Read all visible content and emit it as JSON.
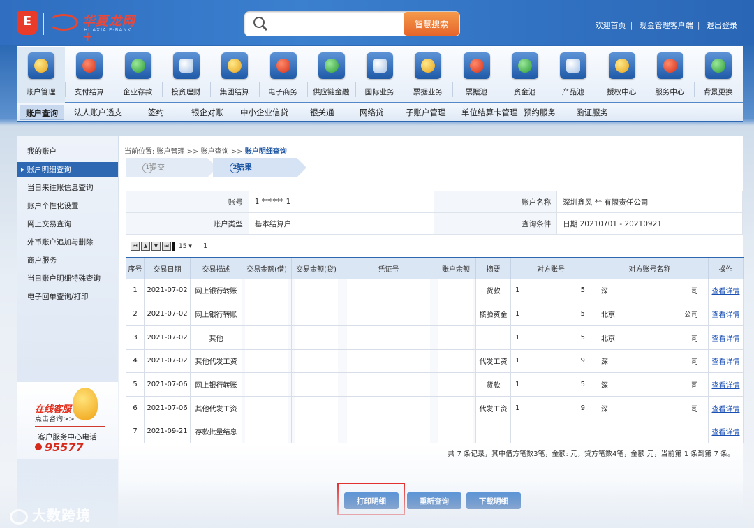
{
  "header": {
    "brand_cn": "华夏龙网+",
    "brand_en": "HUAXIA E-BANK",
    "logo_char": "E",
    "search": {
      "placeholder": "",
      "button": "智慧搜索"
    },
    "links": [
      "欢迎首页",
      "现金管理客户端",
      "退出登录"
    ]
  },
  "nav": [
    "账户管理",
    "支付结算",
    "企业存款",
    "投资理财",
    "集团结算",
    "电子商务",
    "供应链金融",
    "国际业务",
    "票据业务",
    "票据池",
    "资金池",
    "产品池",
    "授权中心",
    "服务中心",
    "背景更换"
  ],
  "subnav": [
    "账户查询",
    "法人账户透支",
    "签约",
    "银企对账",
    "中小企业信贷",
    "银关通",
    "网络贷",
    "子账户管理",
    "单位结算卡管理",
    "预约服务",
    "函证服务"
  ],
  "sidebar": [
    "我的账户",
    "账户明细查询",
    "当日来往账信息查询",
    "账户个性化设置",
    "网上交易查询",
    "外币账户追加与删除",
    "商户服务",
    "当日账户明细特殊查询",
    "电子回单查询/打印"
  ],
  "service": {
    "title": "在线客服",
    "sub": "点击咨询>>",
    "hotline_label": "客户服务中心电话",
    "hotline": "95577"
  },
  "crumb": {
    "prefix": "当前位置: 账户管理 >> 账户查询 >> ",
    "current": "账户明细查询"
  },
  "steps": [
    {
      "num": "1",
      "label": "提交"
    },
    {
      "num": "2",
      "label": "结果"
    }
  ],
  "info": {
    "account_label": "账号",
    "account_value": "1 ****** 1",
    "name_label": "账户名称",
    "name_value": "深圳鑫风 ** 有限责任公司",
    "type_label": "账户类型",
    "type_value": "基本结算户",
    "cond_label": "查询条件",
    "cond_value": "日期 20210701 - 20210921"
  },
  "pager": {
    "page_size": "15",
    "current_page": "1"
  },
  "grid": {
    "headers": [
      "序号",
      "交易日期",
      "交易描述",
      "交易金额(借)",
      "交易金额(贷)",
      "凭证号",
      "账户余额",
      "摘要",
      "对方账号",
      "对方账号名称",
      "操作"
    ],
    "rows": [
      {
        "no": "1",
        "date": "2021-07-02",
        "desc": "网上银行转账",
        "summary": "货款",
        "acct_a": "1",
        "acct_b": "5",
        "name_a": "深",
        "name_b": "司",
        "op": "查看详情"
      },
      {
        "no": "2",
        "date": "2021-07-02",
        "desc": "网上银行转账",
        "summary": "核验资金",
        "acct_a": "1",
        "acct_b": "5",
        "name_a": "北京",
        "name_b": "公司",
        "op": "查看详情"
      },
      {
        "no": "3",
        "date": "2021-07-02",
        "desc": "其他",
        "summary": "",
        "acct_a": "1",
        "acct_b": "5",
        "name_a": "北京",
        "name_b": "司",
        "op": "查看详情"
      },
      {
        "no": "4",
        "date": "2021-07-02",
        "desc": "其他代发工资",
        "summary": "代发工资",
        "acct_a": "1",
        "acct_b": "9",
        "name_a": "深",
        "name_b": "司",
        "op": "查看详情"
      },
      {
        "no": "5",
        "date": "2021-07-06",
        "desc": "网上银行转账",
        "summary": "货款",
        "acct_a": "1",
        "acct_b": "5",
        "name_a": "深",
        "name_b": "司",
        "op": "查看详情"
      },
      {
        "no": "6",
        "date": "2021-07-06",
        "desc": "其他代发工资",
        "summary": "代发工资",
        "acct_a": "1",
        "acct_b": "9",
        "name_a": "深",
        "name_b": "司",
        "op": "查看详情"
      },
      {
        "no": "7",
        "date": "2021-09-21",
        "desc": "存款批量结息",
        "summary": "",
        "acct_a": "",
        "acct_b": "",
        "name_a": "",
        "name_b": "",
        "op": "查看详情"
      }
    ],
    "summary": "共 7 条记录，其中借方笔数3笔，金额:         元，贷方笔数4笔，金额         元，当前第 1 条到第 7 条。"
  },
  "actions": {
    "print": "打印明细",
    "requery": "重新查询",
    "download": "下载明细"
  },
  "watermark": "大数跨境"
}
